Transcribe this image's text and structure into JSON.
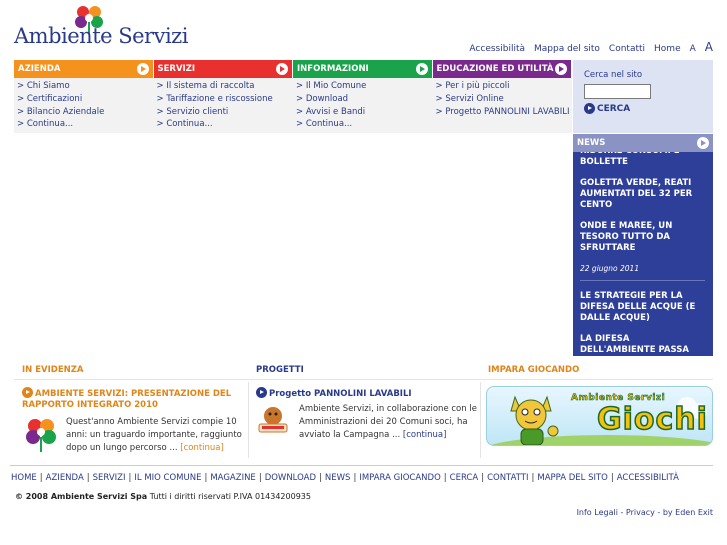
{
  "brand": {
    "name": "Ambiente Servizi"
  },
  "topnav": {
    "items": [
      "Accessibilità",
      "Mappa del sito",
      "Contatti",
      "Home"
    ],
    "text_small": "A",
    "text_large": "A"
  },
  "menu": {
    "tabs": [
      {
        "label": "AZIENDA",
        "color": "#f5921e"
      },
      {
        "label": "SERVIZI",
        "color": "#e8312f"
      },
      {
        "label": "INFORMAZIONI",
        "color": "#1aa34a"
      },
      {
        "label": "EDUCAZIONE ED UTILITÀ",
        "color": "#7a2a8c"
      }
    ],
    "columns": [
      [
        "> Chi Siamo",
        "> Certificazioni",
        "> Bilancio Aziendale",
        "> Continua..."
      ],
      [
        "> Il sistema di raccolta",
        "> Tariffazione e riscossione",
        "> Servizio clienti",
        "> Continua..."
      ],
      [
        "> Il Mio Comune",
        "> Download",
        "> Avvisi e Bandi",
        "> Continua..."
      ],
      [
        "> Per i più piccoli",
        "> Servizi Online",
        "> Progetto PANNOLINI LAVABILI"
      ]
    ]
  },
  "search": {
    "label": "Cerca nel sito",
    "value": "",
    "button": "CERCA"
  },
  "news": {
    "title": "NEWS",
    "cut_top": "RIDURRE CONSUMI E",
    "items": [
      "BOLLETTE",
      "GOLETTA VERDE, REATI AUMENTATI DEL 32 PER CENTO",
      "ONDE E MAREE, UN TESORO TUTTO DA SFRUTTARE"
    ],
    "date": "22 giugno 2011",
    "items2": [
      "LE STRATEGIE PER LA DIFESA DELLE ACQUE (E DALLE ACQUE)",
      "LA DIFESA DELL'AMBIENTE PASSA ANCHE PER"
    ]
  },
  "sections": {
    "evidenza": {
      "title": "IN EVIDENZA",
      "headline": "AMBIENTE SERVIZI: PRESENTAZIONE DEL RAPPORTO INTEGRATO 2010",
      "text": "Quest'anno Ambiente Servizi compie 10 anni: un traguardo importante, raggiunto dopo un lungo percorso ...",
      "more": "[continua]"
    },
    "progetti": {
      "title": "PROGETTI",
      "headline": "Progetto PANNOLINI LAVABILI",
      "text": "Ambiente Servizi, in collaborazione con le Amministrazioni dei 20 Comuni soci, ha avviato la Campagna ...",
      "more": "[continua]"
    },
    "impara": {
      "title": "IMPARA GIOCANDO",
      "banner_brand": "Ambiente Servizi",
      "banner_title": "Giochi"
    }
  },
  "footer": {
    "links": [
      "HOME",
      "AZIENDA",
      "SERVIZI",
      "IL MIO COMUNE",
      "MAGAZINE",
      "DOWNLOAD",
      "NEWS",
      "IMPARA GIOCANDO",
      "CERCA",
      "CONTATTI",
      "MAPPA DEL SITO",
      "ACCESSIBILITÀ"
    ],
    "copyright_bold": "© 2008 Ambiente Servizi Spa",
    "copyright_rest": " Tutti i diritti riservati P.IVA 01434200935",
    "legal": "Info Legali - Privacy - by Eden Exit"
  }
}
